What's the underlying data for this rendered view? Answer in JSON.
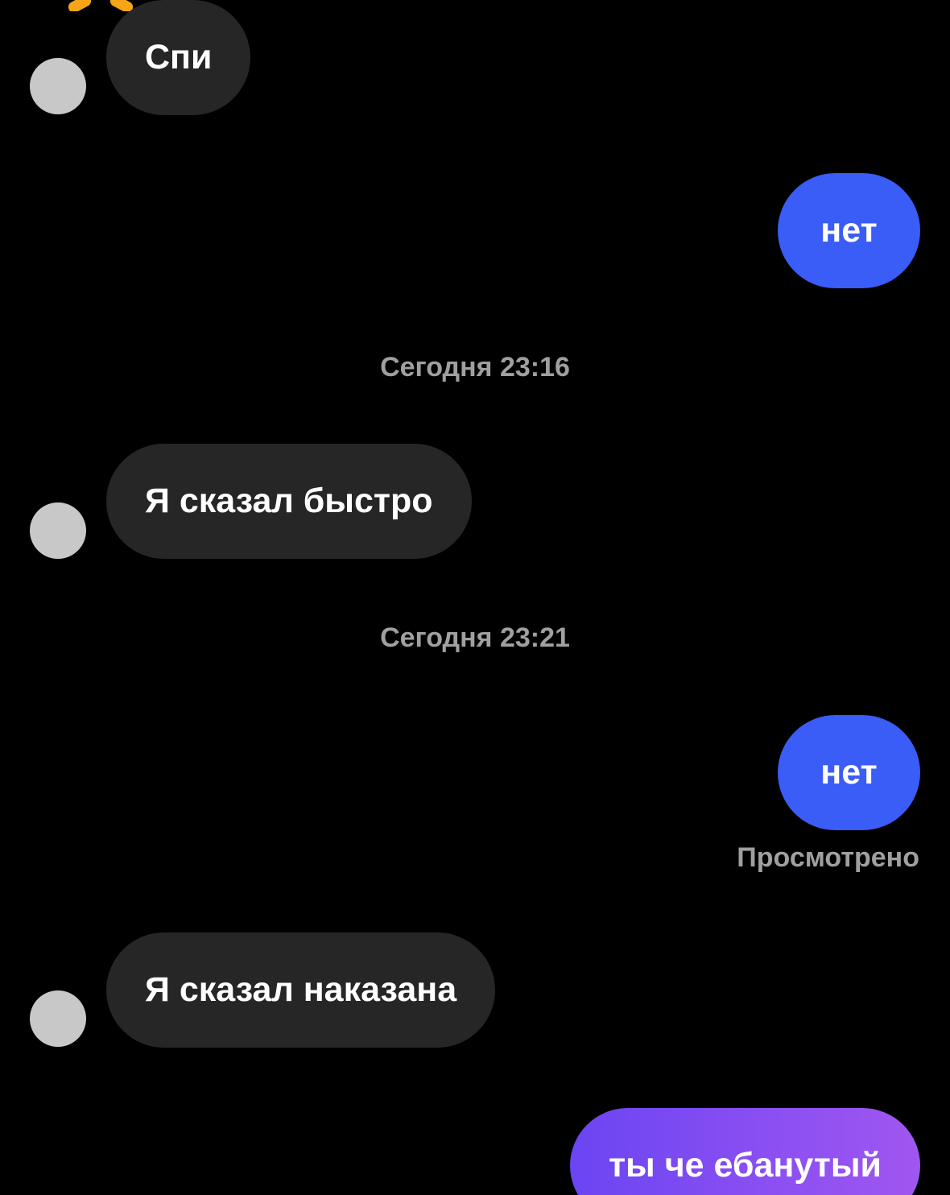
{
  "colors": {
    "background": "#000000",
    "incoming_bubble": "#262626",
    "outgoing_bubble": "#3a5cf7",
    "outgoing_gradient_start": "#6a45f2",
    "outgoing_gradient_end": "#a056f0",
    "meta_text": "#a0a0a0",
    "avatar_placeholder": "#c8c8c8"
  },
  "messages": [
    {
      "direction": "incoming",
      "text": "Спи"
    },
    {
      "direction": "outgoing",
      "text": "нет"
    },
    {
      "timestamp": "Сегодня 23:16"
    },
    {
      "direction": "incoming",
      "text": "Я сказал быстро"
    },
    {
      "timestamp": "Сегодня 23:21"
    },
    {
      "direction": "outgoing",
      "text": "нет",
      "status": "Просмотрено"
    },
    {
      "direction": "incoming",
      "text": "Я сказал наказана"
    },
    {
      "direction": "outgoing",
      "text": "ты че ебанутый"
    }
  ]
}
